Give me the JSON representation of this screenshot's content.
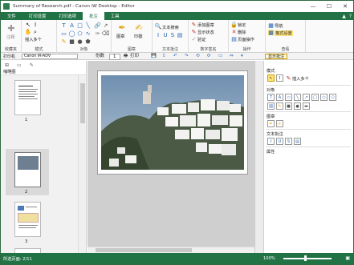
{
  "title": "Summary of Research.pdf - Canon iW Desktop - Editor",
  "window_controls": [
    "—",
    "☐",
    "✕"
  ],
  "menu": [
    "文件",
    "打印设置",
    "打印选项",
    "批注",
    "工具"
  ],
  "menu_right": [
    "▲",
    "?"
  ],
  "ribbon": {
    "g1": {
      "btn": "注释",
      "label": "收藏夹"
    },
    "g2": {
      "multi": "插入多个",
      "label": "模式"
    },
    "g3": {
      "label": "对象"
    },
    "g4": {
      "btn1": "图章",
      "btn2": "印戳",
      "label": "图章"
    },
    "g5": {
      "btn": "文本搜索",
      "label": "文本批注"
    },
    "g6": {
      "a": "添加图章",
      "b": "显示状态",
      "c": "验证",
      "label": "数字签名"
    },
    "g7": {
      "a": "锁定",
      "b": "删除",
      "c": "页面操作",
      "label": "操作"
    },
    "g8": {
      "a": "导航",
      "b": "格式设置",
      "label": "查看"
    }
  },
  "toolrow": {
    "printer_label": "打印机",
    "printer_value": "Canon iR-ADV",
    "copies_label": "份数",
    "copies_value": "1",
    "print_button": "打印",
    "show_annotations": "显示批注"
  },
  "left": {
    "icons": [
      "⊞",
      "▭",
      "✎"
    ],
    "title": "缩略图",
    "pages": [
      "1",
      "2",
      "3"
    ]
  },
  "right": {
    "mode": "模式",
    "insert_multi": "插入多个",
    "objects": "对象",
    "stamps": "图章",
    "text_annot": "文本批注",
    "properties": "属性"
  },
  "status": {
    "page": "所选页面: 2/11",
    "zoom": "100%"
  },
  "colors": {
    "accent": "#217346"
  }
}
